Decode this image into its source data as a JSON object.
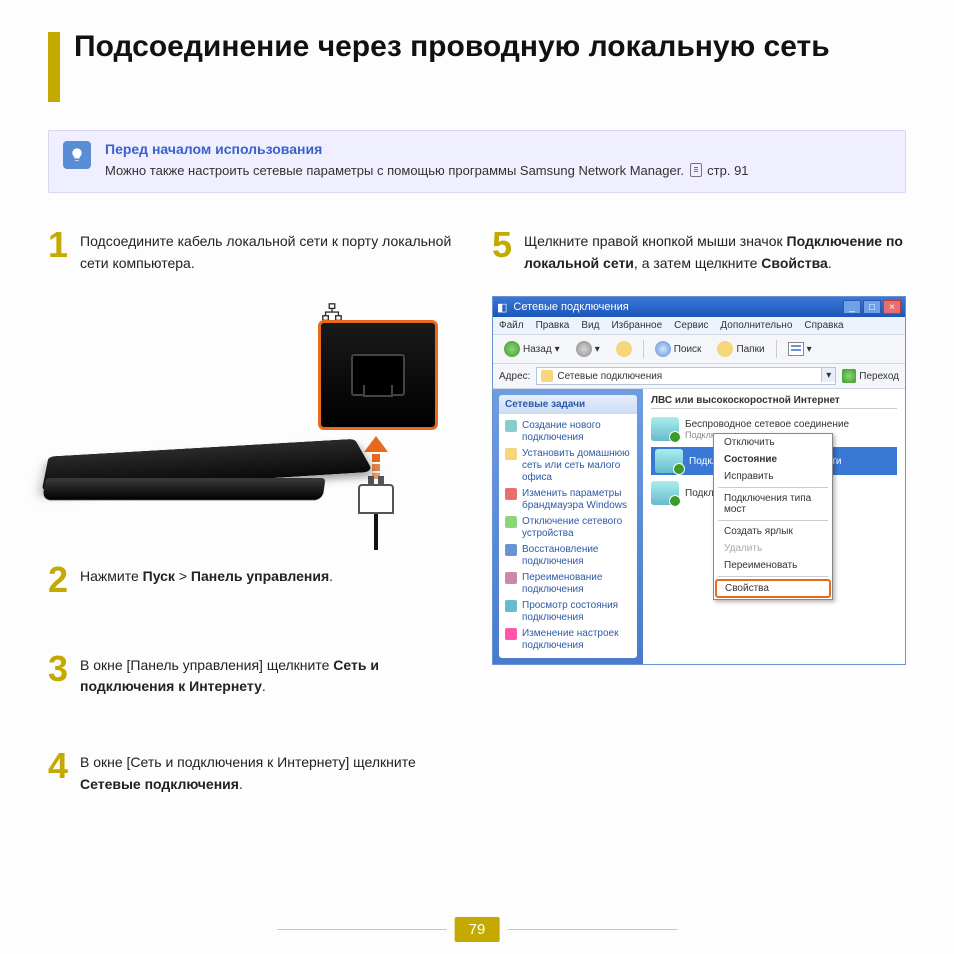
{
  "title": "Подсоединение через проводную локальную сеть",
  "tip": {
    "heading": "Перед началом использования",
    "text_pre": "Можно также настроить сетевые параметры с помощью программы Samsung Network Manager. ",
    "page_ref": "стр. 91"
  },
  "steps": {
    "s1": {
      "num": "1",
      "text": "Подсоедините кабель локальной сети к порту локальной сети компьютера."
    },
    "s2": {
      "num": "2",
      "text_pre": "Нажмите ",
      "b1": "Пуск",
      "sep": " > ",
      "b2": "Панель управления",
      "tail": "."
    },
    "s3": {
      "num": "3",
      "text_pre": "В окне [Панель управления] щелкните ",
      "b1": "Сеть и подключения к Интернету",
      "tail": "."
    },
    "s4": {
      "num": "4",
      "text_pre": "В окне [Сеть и подключения к Интернету] щелкните ",
      "b1": "Сетевые подключения",
      "tail": "."
    },
    "s5": {
      "num": "5",
      "text_pre": "Щелкните правой кнопкой мыши значок ",
      "b1": "Подключение по локальной сети",
      "mid": ", а затем щелкните ",
      "b2": "Свойства",
      "tail": "."
    }
  },
  "win": {
    "title": "Сетевые подключения",
    "menu": [
      "Файл",
      "Правка",
      "Вид",
      "Избранное",
      "Сервис",
      "Дополнительно",
      "Справка"
    ],
    "toolbar": {
      "back": "Назад",
      "search": "Поиск",
      "folders": "Папки"
    },
    "addr_label": "Адрес:",
    "addr_value": "Сетевые подключения",
    "go": "Переход",
    "side_head": "Сетевые задачи",
    "side_items": [
      "Создание нового подключения",
      "Установить домашнюю сеть или сеть малого офиса",
      "Изменить параметры брандмауэра Windows",
      "Отключение сетевого устройства",
      "Восстановление подключения",
      "Переименование подключения",
      "Просмотр состояния подключения",
      "Изменение настроек подключения"
    ],
    "main_head": "ЛВС или высокоскоростной Интернет",
    "conn1": {
      "name": "Беспроводное сетевое соединение",
      "status": "Подключено"
    },
    "conn2": {
      "name": "Подключение по локальной сети"
    },
    "conn3": {
      "name": "Подключения типа мост"
    },
    "ctx": [
      "Отключить",
      "Состояние",
      "Исправить",
      "—sep—",
      "Подключения типа мост",
      "—sep—",
      "Создать ярлык",
      "Удалить",
      "Переименовать",
      "—sep—",
      "Свойства"
    ]
  },
  "page_number": "79"
}
